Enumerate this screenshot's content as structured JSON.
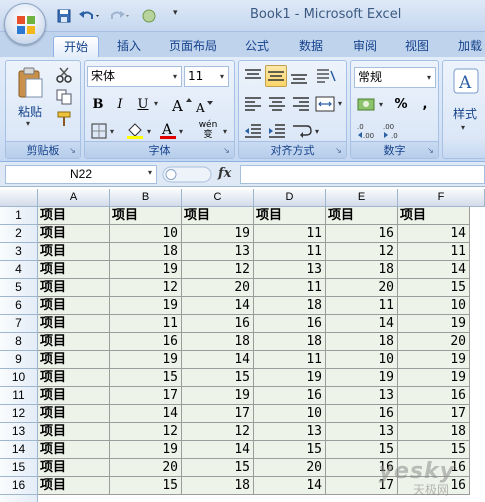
{
  "window": {
    "title": "Book1 - Microsoft Excel"
  },
  "tabs": [
    {
      "label": "开始",
      "active": true
    },
    {
      "label": "插入"
    },
    {
      "label": "页面布局"
    },
    {
      "label": "公式"
    },
    {
      "label": "数据"
    },
    {
      "label": "审阅"
    },
    {
      "label": "视图"
    },
    {
      "label": "加载"
    }
  ],
  "ribbon": {
    "clipboard": {
      "label": "剪贴板",
      "paste_label": "粘贴"
    },
    "font": {
      "label": "字体",
      "font_name": "宋体",
      "font_size": "11",
      "bold": "B",
      "italic": "I",
      "underline": "U",
      "wen": "wén 变"
    },
    "alignment": {
      "label": "对齐方式"
    },
    "number": {
      "label": "数字",
      "format": "常规",
      "percent": "%",
      "comma": ","
    },
    "styles": {
      "label": "样式"
    }
  },
  "formula_bar": {
    "name_box": "N22",
    "fx": "fx",
    "formula": ""
  },
  "sheet": {
    "columns": [
      "A",
      "B",
      "C",
      "D",
      "E",
      "F"
    ],
    "header_row": [
      "项目",
      "项目",
      "项目",
      "项目",
      "项目",
      "项目"
    ],
    "label": "项目",
    "rows": [
      [
        10,
        19,
        11,
        16,
        14
      ],
      [
        18,
        13,
        11,
        12,
        11
      ],
      [
        19,
        12,
        13,
        18,
        14
      ],
      [
        12,
        20,
        11,
        20,
        15
      ],
      [
        19,
        14,
        18,
        11,
        10
      ],
      [
        11,
        16,
        16,
        14,
        19
      ],
      [
        16,
        18,
        18,
        18,
        20
      ],
      [
        19,
        14,
        11,
        10,
        19
      ],
      [
        15,
        15,
        19,
        19,
        19
      ],
      [
        17,
        19,
        16,
        13,
        16
      ],
      [
        14,
        17,
        10,
        16,
        17
      ],
      [
        12,
        12,
        13,
        13,
        18
      ],
      [
        19,
        14,
        15,
        15,
        15
      ],
      [
        20,
        15,
        20,
        16,
        16
      ],
      [
        15,
        18,
        14,
        17,
        16
      ]
    ]
  },
  "watermark": {
    "main": "yesky",
    "sub": "天极网"
  }
}
